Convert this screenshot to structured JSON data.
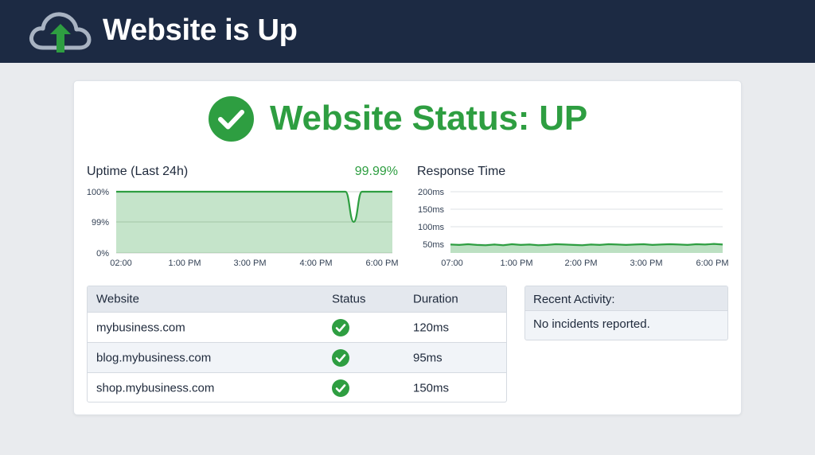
{
  "header": {
    "title": "Website is Up",
    "icon": "cloud-upload-icon"
  },
  "status": {
    "headline": "Website Status: UP",
    "icon": "check-circle-icon",
    "color": "#2e9e41"
  },
  "uptime": {
    "title": "Uptime (Last 24h)",
    "value": "99.99%"
  },
  "response": {
    "title": "Response Time"
  },
  "chart_data": [
    {
      "type": "area",
      "title": "Uptime (Last 24h)",
      "y_tick_labels": [
        "100%",
        "99%",
        "0%"
      ],
      "x_tick_labels": [
        "02:00",
        "1:00 PM",
        "3:00 PM",
        "4:00 PM",
        "6:00 PM"
      ],
      "series": [
        {
          "name": "",
          "points": [
            [
              0,
              100
            ],
            [
              0.8,
              100
            ],
            [
              0.83,
              100
            ],
            [
              0.86,
              99
            ],
            [
              0.89,
              100
            ],
            [
              0.92,
              100
            ],
            [
              1,
              100
            ]
          ]
        }
      ],
      "grid": true,
      "color": "#2e9e41"
    },
    {
      "type": "area",
      "title": "Response Time",
      "y_tick_labels": [
        "200ms",
        "150ms",
        "100ms",
        "50ms"
      ],
      "y_ticks": [
        200,
        150,
        100,
        50
      ],
      "ylim": [
        0,
        225
      ],
      "x_tick_labels": [
        "07:00",
        "1:00 PM",
        "2:00 PM",
        "3:00 PM",
        "6:00 PM"
      ],
      "series": [
        {
          "name": "",
          "values": [
            49,
            48,
            50,
            48,
            47,
            49,
            47,
            50,
            48,
            49,
            47,
            48,
            50,
            49,
            48,
            47,
            49,
            48,
            50,
            49,
            48,
            49,
            50,
            48,
            49,
            50,
            49,
            48,
            50,
            49,
            51,
            49
          ]
        }
      ],
      "grid": true,
      "color": "#2e9e41"
    }
  ],
  "table": {
    "headers": [
      "Website",
      "Status",
      "Duration"
    ],
    "rows": [
      {
        "site": "mybusiness.com",
        "status_icon": "check-circle-icon",
        "duration": "120ms"
      },
      {
        "site": "blog.mybusiness.com",
        "status_icon": "check-circle-icon",
        "duration": "95ms"
      },
      {
        "site": "shop.mybusiness.com",
        "status_icon": "check-circle-icon",
        "duration": "150ms"
      }
    ]
  },
  "activity": {
    "title": "Recent Activity:",
    "message": "No incidents reported."
  }
}
